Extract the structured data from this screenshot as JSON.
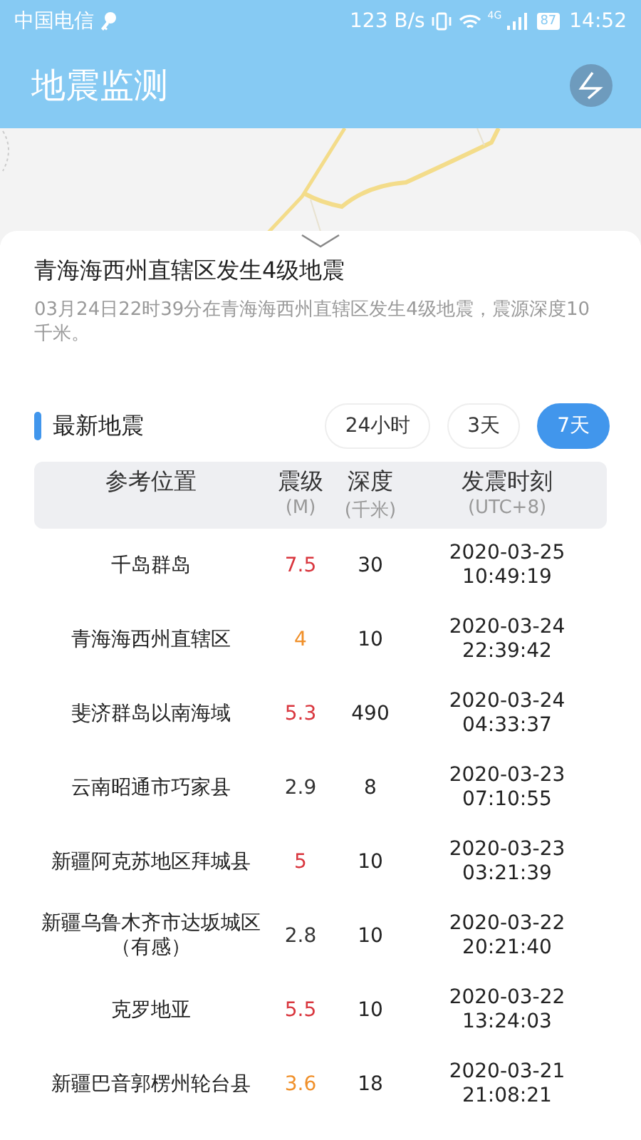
{
  "status_bar": {
    "carrier": "中国电信",
    "speed": "123 B/s",
    "network": "4G",
    "battery": "87",
    "time": "14:52"
  },
  "app_bar": {
    "title": "地震监测"
  },
  "latest": {
    "title": "青海海西州直辖区发生4级地震",
    "description": "03月24日22时39分在青海海西州直辖区发生4级地震，震源深度10千米。"
  },
  "section": {
    "title": "最新地震"
  },
  "filters": [
    {
      "label": "24小时",
      "selected": false
    },
    {
      "label": "3天",
      "selected": false
    },
    {
      "label": "7天",
      "selected": true
    }
  ],
  "table": {
    "columns": [
      {
        "label": "参考位置"
      },
      {
        "label": "震级",
        "unit": "(M)"
      },
      {
        "label": "深度",
        "unit": "(千米)"
      },
      {
        "label": "发震时刻",
        "unit": "(UTC+8)"
      }
    ],
    "rows": [
      {
        "location": "千岛群岛",
        "magnitude": "7.5",
        "color": "#d9363e",
        "depth": "30",
        "date": "2020-03-25",
        "time": "10:49:19"
      },
      {
        "location": "青海海西州直辖区",
        "magnitude": "4",
        "color": "#f0902a",
        "depth": "10",
        "date": "2020-03-24",
        "time": "22:39:42"
      },
      {
        "location": "斐济群岛以南海域",
        "magnitude": "5.3",
        "color": "#d9363e",
        "depth": "490",
        "date": "2020-03-24",
        "time": "04:33:37"
      },
      {
        "location": "云南昭通市巧家县",
        "magnitude": "2.9",
        "color": "#333333",
        "depth": "8",
        "date": "2020-03-23",
        "time": "07:10:55"
      },
      {
        "location": "新疆阿克苏地区拜城县",
        "magnitude": "5",
        "color": "#d9363e",
        "depth": "10",
        "date": "2020-03-23",
        "time": "03:21:39"
      },
      {
        "location": "新疆乌鲁木齐市达坂城区（有感）",
        "magnitude": "2.8",
        "color": "#333333",
        "depth": "10",
        "date": "2020-03-22",
        "time": "20:21:40"
      },
      {
        "location": "克罗地亚",
        "magnitude": "5.5",
        "color": "#d9363e",
        "depth": "10",
        "date": "2020-03-22",
        "time": "13:24:03"
      },
      {
        "location": "新疆巴音郭楞州轮台县",
        "magnitude": "3.6",
        "color": "#f0902a",
        "depth": "18",
        "date": "2020-03-21",
        "time": "21:08:21"
      }
    ]
  }
}
